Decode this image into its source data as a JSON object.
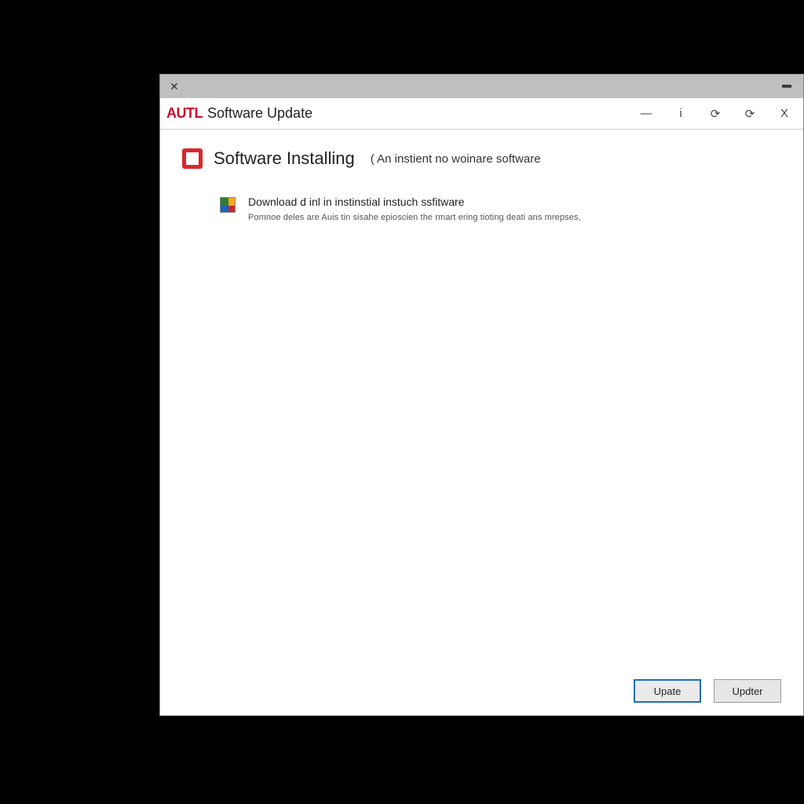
{
  "outer": {
    "close_glyph": "✕",
    "minimize_glyph": "━"
  },
  "window": {
    "brand": "AUTL",
    "title": "Software Update",
    "controls": {
      "minimize": "—",
      "info": "i",
      "help": "⟳",
      "restore": "⟳",
      "close": "X"
    }
  },
  "main": {
    "heading": "Software Installing",
    "heading_note": "( An instient no woinare software",
    "item": {
      "title": "Download d inl in instinstial instuch ssfitware",
      "description": "Pomnoe deles are Auis tin sisahe epioscien the rmart ering tioting deati ans mrepses,"
    }
  },
  "footer": {
    "primary_label": "Upate",
    "secondary_label": "Updter"
  }
}
